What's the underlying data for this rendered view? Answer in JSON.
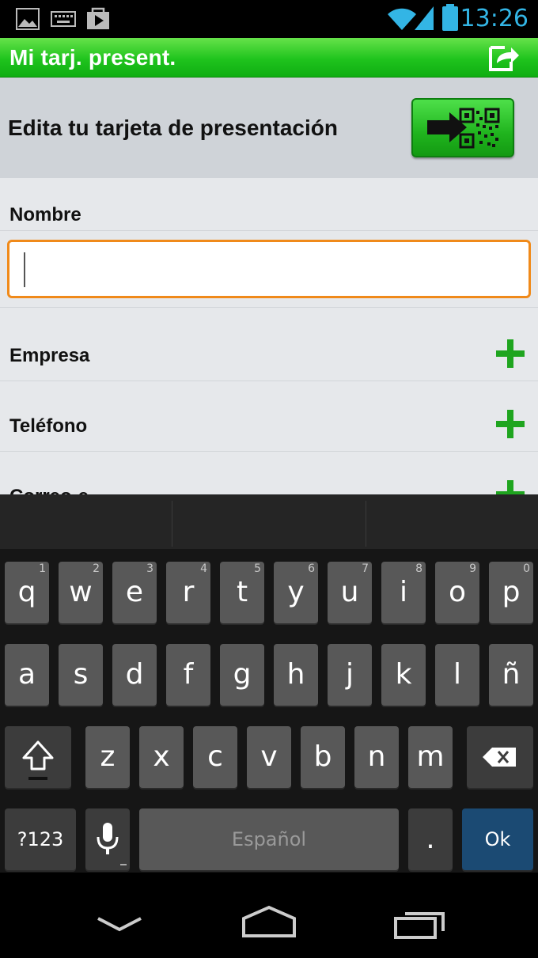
{
  "status_bar": {
    "time": "13:26",
    "icons": [
      "gallery-icon",
      "keyboard-icon",
      "play-store-icon",
      "wifi-icon",
      "signal-icon",
      "battery-icon"
    ],
    "accent": "#33b5e5"
  },
  "action_bar": {
    "title": "Mi tarj. present.",
    "share_icon": "share-icon",
    "color": "#1fc41d"
  },
  "header": {
    "title": "Edita tu tarjeta de presentación",
    "qr_button_icon": "qr-arrow-icon"
  },
  "form": {
    "name_label": "Nombre",
    "name_value": "",
    "fields": [
      {
        "label": "Empresa"
      },
      {
        "label": "Teléfono"
      },
      {
        "label": "Correo-e"
      }
    ],
    "add_icon": "plus-icon",
    "focus_color": "#f08a1a"
  },
  "keyboard": {
    "row1": [
      {
        "key": "q",
        "hint": "1"
      },
      {
        "key": "w",
        "hint": "2"
      },
      {
        "key": "e",
        "hint": "3"
      },
      {
        "key": "r",
        "hint": "4"
      },
      {
        "key": "t",
        "hint": "5"
      },
      {
        "key": "y",
        "hint": "6"
      },
      {
        "key": "u",
        "hint": "7"
      },
      {
        "key": "i",
        "hint": "8"
      },
      {
        "key": "o",
        "hint": "9"
      },
      {
        "key": "p",
        "hint": "0"
      }
    ],
    "row2": [
      "a",
      "s",
      "d",
      "f",
      "g",
      "h",
      "j",
      "k",
      "l",
      "ñ"
    ],
    "row3": [
      "z",
      "x",
      "c",
      "v",
      "b",
      "n",
      "m"
    ],
    "symbols_label": "?123",
    "space_label": "Español",
    "period_label": ".",
    "ok_label": "Ok",
    "shift_icon": "shift-icon",
    "backspace_icon": "backspace-icon",
    "mic_icon": "microphone-icon"
  },
  "nav_bar": {
    "icons": [
      "back-icon",
      "home-icon",
      "recent-apps-icon"
    ]
  }
}
